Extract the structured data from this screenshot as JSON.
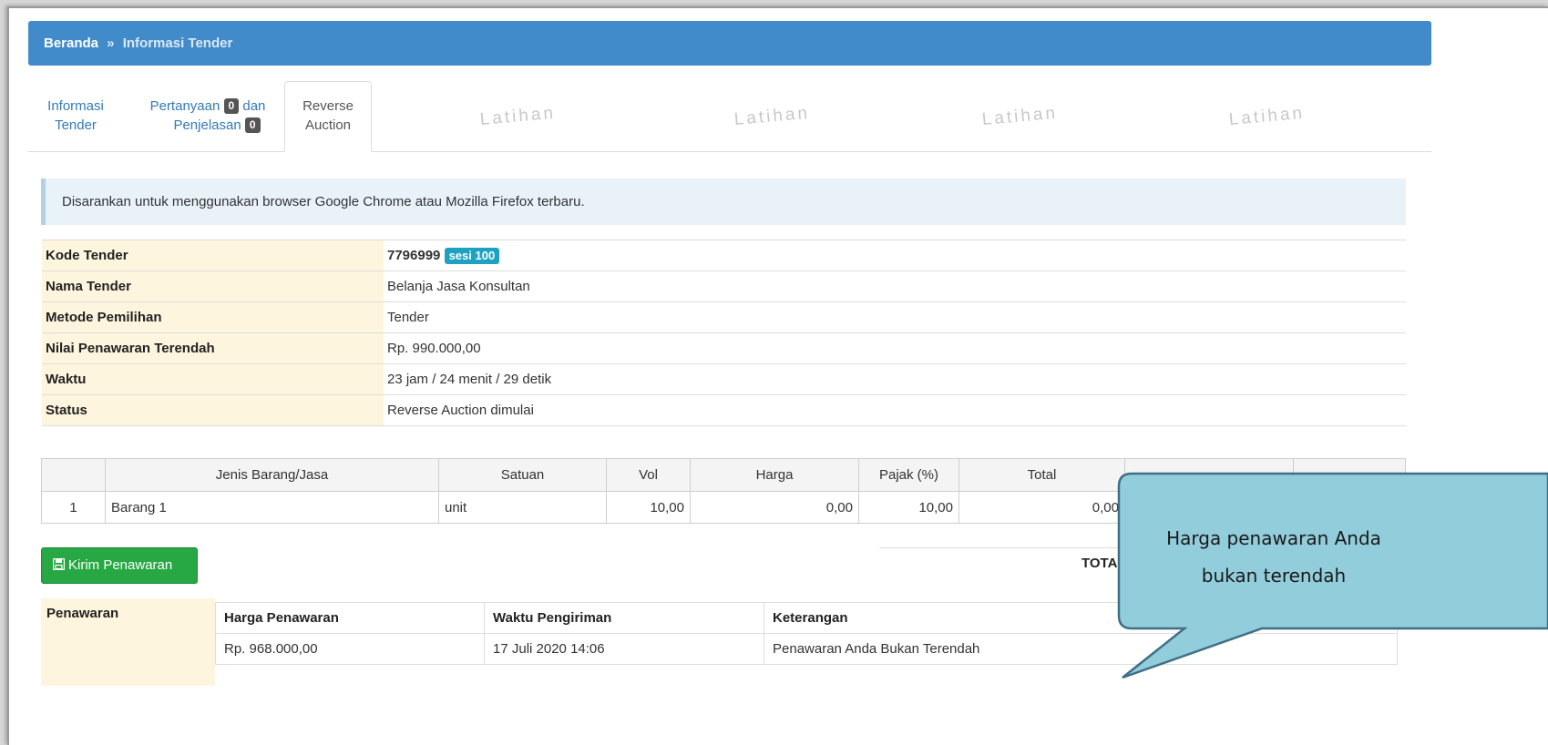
{
  "breadcrumb": {
    "home": "Beranda",
    "separator": "»",
    "current": "Informasi Tender"
  },
  "watermark_text": "Latihan",
  "tabs": [
    {
      "line1": "Informasi",
      "line2": "Tender"
    },
    {
      "line1": "Pertanyaan",
      "badge1": "0",
      "mid": "dan",
      "line2": "Penjelasan",
      "badge2": "0"
    },
    {
      "line1": "Reverse",
      "line2": "Auction",
      "active": true
    }
  ],
  "alert": "Disarankan untuk menggunakan browser Google Chrome atau Mozilla Firefox terbaru.",
  "info": {
    "kode_label": "Kode Tender",
    "kode_value": "7796999",
    "sesi": "sesi 100",
    "nama_label": "Nama Tender",
    "nama_value": "Belanja Jasa Konsultan",
    "metode_label": "Metode Pemilihan",
    "metode_value": "Tender",
    "nilai_label": "Nilai Penawaran Terendah",
    "nilai_value": "Rp. 990.000,00",
    "waktu_label": "Waktu",
    "waktu_value": "23 jam / 24 menit / 29 detik",
    "status_label": "Status",
    "status_value": "Reverse Auction dimulai"
  },
  "items": {
    "headers": [
      "",
      "Jenis Barang/Jasa",
      "Satuan",
      "Vol",
      "Harga",
      "Pajak (%)",
      "Total",
      "",
      ""
    ],
    "rows": [
      {
        "no": "1",
        "jenis": "Barang 1",
        "satuan": "unit",
        "vol": "10,00",
        "harga": "0,00",
        "pajak": "10,00",
        "total": "0,00"
      }
    ],
    "total_label": "TOTA"
  },
  "kirim_button": "Kirim Penawaran",
  "offers": {
    "section_label": "Penawaran",
    "headers": [
      "Harga Penawaran",
      "Waktu Pengiriman",
      "Keterangan"
    ],
    "rows": [
      {
        "harga": "Rp. 968.000,00",
        "waktu": "17 Juli 2020 14:06",
        "keterangan": "Penawaran Anda Bukan Terendah"
      }
    ]
  },
  "callout": {
    "line1": "Harga penawaran Anda",
    "line2": "bukan terendah",
    "color": "#92cddc"
  }
}
